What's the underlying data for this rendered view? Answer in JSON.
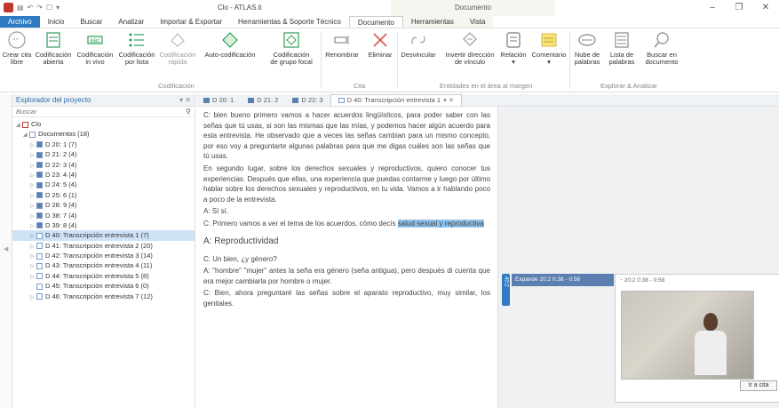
{
  "app_title": "Clo - ATLAS.ti",
  "context_group": "Documento",
  "tabs": [
    {
      "label": "Archivo",
      "style": "file"
    },
    {
      "label": "Inicio",
      "style": ""
    },
    {
      "label": "Buscar",
      "style": ""
    },
    {
      "label": "Analizar",
      "style": ""
    },
    {
      "label": "Importar & Exportar",
      "style": ""
    },
    {
      "label": "Herramientas & Soporte Técnico",
      "style": ""
    },
    {
      "label": "Documento",
      "style": "active"
    },
    {
      "label": "Herramientas",
      "style": "ctx"
    },
    {
      "label": "Vista",
      "style": "ctx"
    }
  ],
  "ribbon": {
    "crear_cita": "Crear cita\nlibre",
    "cod_abierta": "Codificación\nabierta",
    "cod_invivo": "Codificación\nin vivo",
    "cod_lista": "Codificación\npor lista",
    "cod_rapida": "Codificación\nrápida",
    "auto_cod": "Auto-codificación",
    "cod_grupo": "Codificación\nde grupo focal",
    "renombrar": "Renombrar",
    "eliminar": "Eliminar",
    "desvincular": "Desvincular",
    "invertir": "Invertir dirección\nde vínculo",
    "relacion": "Relación",
    "comentario": "Comentario",
    "nube": "Nube de\npalabras",
    "lista_palabras": "Lista de\npalabras",
    "buscar_doc": "Buscar en\ndocumento",
    "group_codificacion": "Codificación",
    "group_cita": "Cita",
    "group_entidades": "Entidades en el área al margen",
    "group_explorar": "Explorar & Analizar"
  },
  "explorer": {
    "title": "Explorador del proyecto",
    "pin": "▾ ✕",
    "search_placeholder": "Buscar",
    "items": [
      {
        "label": "Clo",
        "level": 0,
        "arrow": "◢",
        "icon": "project"
      },
      {
        "label": "Documentos (18)",
        "level": 1,
        "arrow": "◢",
        "icon": "folder"
      },
      {
        "label": "D 20: 1 (7)",
        "level": 2,
        "arrow": "▷",
        "icon": "video"
      },
      {
        "label": "D 21: 2 (4)",
        "level": 2,
        "arrow": "▷",
        "icon": "video"
      },
      {
        "label": "D 22: 3 (4)",
        "level": 2,
        "arrow": "▷",
        "icon": "video"
      },
      {
        "label": "D 23: 4 (4)",
        "level": 2,
        "arrow": "▷",
        "icon": "video"
      },
      {
        "label": "D 24: 5 (4)",
        "level": 2,
        "arrow": "▷",
        "icon": "video"
      },
      {
        "label": "D 25: 6 (1)",
        "level": 2,
        "arrow": "▷",
        "icon": "video"
      },
      {
        "label": "D 28: 9 (4)",
        "level": 2,
        "arrow": "▷",
        "icon": "video"
      },
      {
        "label": "D 38: 7 (4)",
        "level": 2,
        "arrow": "▷",
        "icon": "video"
      },
      {
        "label": "D 39: 8 (4)",
        "level": 2,
        "arrow": "▷",
        "icon": "video"
      },
      {
        "label": "D 40: Transcripción entrevista 1 (7)",
        "level": 2,
        "arrow": "▷",
        "icon": "text",
        "selected": true
      },
      {
        "label": "D 41: Transcripción entrevista 2 (20)",
        "level": 2,
        "arrow": "▷",
        "icon": "text"
      },
      {
        "label": "D 42: Transcripción entrevista 3 (14)",
        "level": 2,
        "arrow": "▷",
        "icon": "text"
      },
      {
        "label": "D 43: Transcripción entrevista 4 (11)",
        "level": 2,
        "arrow": "▷",
        "icon": "text"
      },
      {
        "label": "D 44: Transcripción entrevista 5 (8)",
        "level": 2,
        "arrow": "▷",
        "icon": "text"
      },
      {
        "label": "D 45: Transcripción entrevista 6 (0)",
        "level": 2,
        "arrow": "",
        "icon": "text"
      },
      {
        "label": "D 46: Transcripción entrevista 7 (12)",
        "level": 2,
        "arrow": "▷",
        "icon": "text"
      }
    ]
  },
  "doc_tabs": [
    {
      "label": "D 20: 1",
      "active": false
    },
    {
      "label": "D 21: 2",
      "active": false
    },
    {
      "label": "D 22: 3",
      "active": false
    },
    {
      "label": "D 40: Transcripción entrevista 1",
      "active": true
    }
  ],
  "doc_tab_close": "▾ ✕",
  "document": {
    "paragraphs": [
      {
        "text": "C: bien bueno primero vamos a hacer acuerdos lingüísticos, para poder saber con las señas que tú usas, si son las mismas que las mías, y podemos hacer algún acuerdo para esta entrevista. He observado que a veces las señas cambian para un mismo concepto, por eso voy a preguntarte algunas palabras para que me digas cuáles son las señas que tú usas.",
        "style": ""
      },
      {
        "text": "En segundo lugar, sobre los derechos sexuales y reproductivos, quiero conocer tus experiencias. Después que ellas, una experiencia que puedas contarme y luego por último hablar sobre los derechos sexuales y reproductivos, en tu vida. Vamos a ir hablando poco a poco de la entrevista.",
        "style": ""
      },
      {
        "text": "A: Sí sí.",
        "style": ""
      },
      {
        "text": "C: Primero vamos a ver el tema de los acuerdos, cómo decís",
        "style": "",
        "highlight": "salud sexual y reproductiva"
      },
      {
        "text": "A: Reproductividad",
        "style": "heading"
      },
      {
        "text": "C: Un bien, ¿y género?",
        "style": ""
      },
      {
        "text": "A: \"hombre\" \"mujer\" antes la seña era género (seña antigua), pero después di cuenta que era mejor cambiarla por hombre o mujer.",
        "style": ""
      },
      {
        "text": "C: Bien, ahora preguntaré las señas sobre el aparato reproductivo, muy similar, los genitales.",
        "style": ""
      }
    ]
  },
  "margin": {
    "quote_marker": "40:2",
    "video_bar": "Expande 20:2 0:38 - 0:58",
    "video_card_title": "20:2 0:38 - 0:58",
    "goto_label": "Ir a cita"
  },
  "colors": {
    "accent": "#2e7bc4",
    "selection": "#cfe3f7",
    "highlight": "#8fc2ea"
  }
}
